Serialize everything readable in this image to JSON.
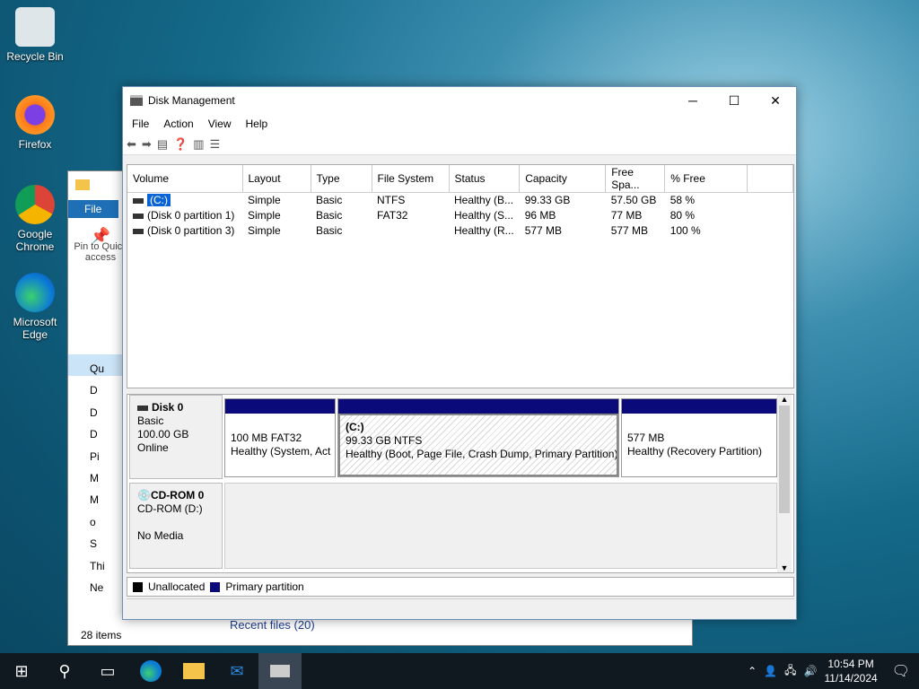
{
  "desktop": {
    "recycle": "Recycle Bin",
    "firefox": "Firefox",
    "chrome": "Google Chrome",
    "edge": "Microsoft Edge"
  },
  "explorer": {
    "file_tab": "File",
    "pin": "Pin to Quick access",
    "items": [
      "Qu",
      "D",
      "D",
      "D",
      "Pi",
      "M",
      "M",
      "o",
      "S",
      "Thi",
      "Ne"
    ],
    "count": "28 items",
    "recent": "Recent files (20)"
  },
  "window": {
    "title": "Disk Management",
    "menu": [
      "File",
      "Action",
      "View",
      "Help"
    ]
  },
  "volumes": {
    "columns": [
      "Volume",
      "Layout",
      "Type",
      "File System",
      "Status",
      "Capacity",
      "Free Spa...",
      "% Free"
    ],
    "rows": [
      [
        "(C:)",
        "Simple",
        "Basic",
        "NTFS",
        "Healthy (B...",
        "99.33 GB",
        "57.50 GB",
        "58 %"
      ],
      [
        "(Disk 0 partition 1)",
        "Simple",
        "Basic",
        "FAT32",
        "Healthy (S...",
        "96 MB",
        "77 MB",
        "80 %"
      ],
      [
        "(Disk 0 partition 3)",
        "Simple",
        "Basic",
        "",
        "Healthy (R...",
        "577 MB",
        "577 MB",
        "100 %"
      ]
    ]
  },
  "disk0": {
    "name": "Disk 0",
    "type": "Basic",
    "size": "100.00 GB",
    "state": "Online",
    "p1": {
      "size": "100 MB FAT32",
      "status": "Healthy (System, Act"
    },
    "p2": {
      "label": "(C:)",
      "size": "99.33 GB NTFS",
      "status": "Healthy (Boot, Page File, Crash Dump, Primary Partition)"
    },
    "p3": {
      "size": "577 MB",
      "status": "Healthy (Recovery Partition)"
    }
  },
  "cdrom": {
    "name": "CD-ROM 0",
    "drive": "CD-ROM (D:)",
    "media": "No Media"
  },
  "legend": {
    "unalloc": "Unallocated",
    "primary": "Primary partition",
    "colors": {
      "unalloc": "#000000",
      "primary": "#0a0a7a"
    }
  },
  "clock": {
    "time": "10:54 PM",
    "date": "11/14/2024"
  }
}
